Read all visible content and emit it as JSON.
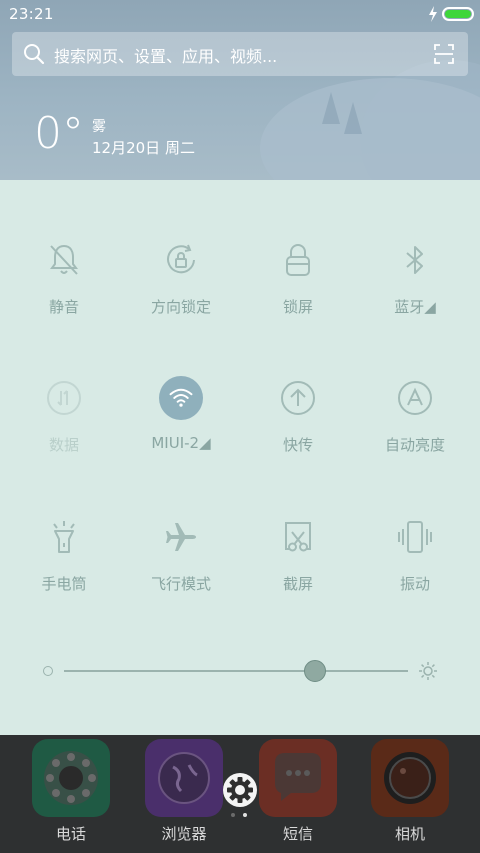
{
  "status": {
    "time": "23:21"
  },
  "search": {
    "placeholder": "搜索网页、设置、应用、视频..."
  },
  "weather": {
    "temperature": "0°",
    "condition": "雾",
    "date": "12月20日 周二"
  },
  "toggles": [
    {
      "label": "静音",
      "icon": "bell-off-icon",
      "enabled": false
    },
    {
      "label": "方向锁定",
      "icon": "rotation-lock-icon",
      "enabled": false
    },
    {
      "label": "锁屏",
      "icon": "lock-icon",
      "enabled": false
    },
    {
      "label": "蓝牙◢",
      "icon": "bluetooth-icon",
      "enabled": false
    },
    {
      "label": "数据",
      "icon": "mobile-data-icon",
      "enabled": false
    },
    {
      "label": "MIUI-2◢",
      "icon": "wifi-icon",
      "enabled": true
    },
    {
      "label": "快传",
      "icon": "quick-transfer-icon",
      "enabled": false
    },
    {
      "label": "自动亮度",
      "icon": "auto-brightness-icon",
      "enabled": false
    },
    {
      "label": "手电筒",
      "icon": "flashlight-icon",
      "enabled": false
    },
    {
      "label": "飞行模式",
      "icon": "airplane-icon",
      "enabled": false
    },
    {
      "label": "截屏",
      "icon": "screenshot-icon",
      "enabled": false
    },
    {
      "label": "振动",
      "icon": "vibrate-icon",
      "enabled": false
    }
  ],
  "brightness": {
    "level": 0.73
  },
  "dock": {
    "apps": [
      {
        "name": "电话",
        "icon": "phone-app-icon",
        "color": "#1f5a44"
      },
      {
        "name": "浏览器",
        "icon": "browser-app-icon",
        "color": "#4a2f6b"
      },
      {
        "name": "短信",
        "icon": "messages-app-icon",
        "color": "#6b2e24"
      },
      {
        "name": "相机",
        "icon": "camera-app-icon",
        "color": "#5a2a18"
      }
    ]
  },
  "colors": {
    "panel_bg": "#d8eae5",
    "accent": "#8fb0bc",
    "battery": "#3ed63a"
  }
}
